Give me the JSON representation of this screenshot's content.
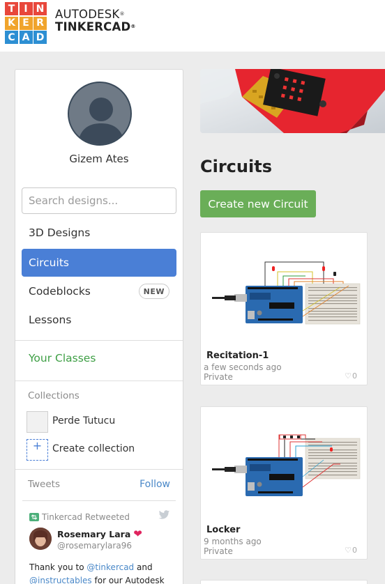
{
  "header": {
    "logo_letters": [
      "T",
      "I",
      "N",
      "K",
      "E",
      "R",
      "C",
      "A",
      "D"
    ],
    "logo_colors": [
      "#e8473b",
      "#e8473b",
      "#e8473b",
      "#f0a42c",
      "#f0a42c",
      "#f0a42c",
      "#2d8fd3",
      "#2d8fd3",
      "#2d8fd3"
    ],
    "brand_line1": "AUTODESK",
    "brand_line2": "TINKERCAD",
    "reg_mark": "®"
  },
  "sidebar": {
    "user_name": "Gizem Ates",
    "search_placeholder": "Search designs...",
    "nav": [
      {
        "label": "3D Designs",
        "active": false
      },
      {
        "label": "Circuits",
        "active": true
      },
      {
        "label": "Codeblocks",
        "active": false,
        "badge": "NEW"
      },
      {
        "label": "Lessons",
        "active": false
      }
    ],
    "your_classes": "Your Classes",
    "collections_label": "Collections",
    "collections": [
      {
        "name": "Perde Tutucu"
      }
    ],
    "create_collection": "Create collection",
    "create_collection_icon": "+",
    "tweets_label": "Tweets",
    "follow_label": "Follow",
    "tweet": {
      "retweeted_by": "Tinkercad Retweeted",
      "author": "Rosemary Lara",
      "handle": "@rosemarylara96",
      "text_1": "Thank you to ",
      "mention_1": "@tinkercad",
      "text_2": " and",
      "mention_2": "@instructables",
      "text_3": " for our Autodesk"
    }
  },
  "main": {
    "title": "Circuits",
    "create_button": "Create new Circuit",
    "cards": [
      {
        "title": "Recitation-1",
        "time": "a few seconds ago",
        "privacy": "Private",
        "likes": "0"
      },
      {
        "title": "Locker",
        "time": "9 months ago",
        "privacy": "Private",
        "likes": "0"
      }
    ]
  },
  "colors": {
    "accent_blue": "#4a7fd6",
    "green_button": "#6aae58",
    "classes_green": "#3e9f45",
    "link_blue": "#4a88c8"
  },
  "icons": {
    "retweet": "retweet-icon",
    "twitter": "twitter-bird-icon",
    "heart": "heart-icon",
    "add": "plus-icon"
  }
}
